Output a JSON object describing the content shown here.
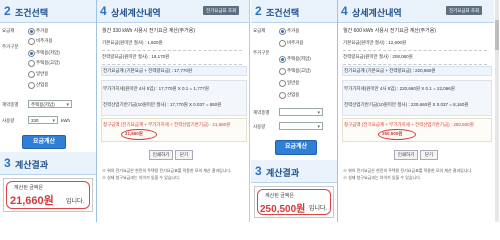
{
  "left": {
    "sidebar": {
      "step_num": "2",
      "step_title": "조건선택",
      "labels": [
        "요금제",
        "주거구분",
        "계약종별",
        "사용량"
      ],
      "radios": [
        "주거용",
        "비주거용",
        "주택용(저압)",
        "주택용(고압)",
        "일반용",
        "산업용"
      ],
      "select_value": "주택용(저압)",
      "usage_value": "330",
      "usage_unit": "kWh",
      "calc_button": "요금계산"
    },
    "result": {
      "step_num": "3",
      "step_title": "계산결과",
      "label": "계산된 금액은",
      "value": "21,660원",
      "unit": "입니다."
    },
    "main": {
      "step_num": "4",
      "step_title": "상세계산내역",
      "subtitle": "월간 330 kWh 사용시 전기요금 계산(주거용)",
      "header_button": "전기요금표 조회",
      "lines": [
        "기본요금(원미만 절사) : 1,600원",
        "전력량요금(원미만 절사) : 16,170원",
        "전기요금계 (기본요금 + 전력량요금) : 17,770원",
        "부가가치세(원미만 4사 5입) : 17,770원 X 0.1 = 1,777원",
        "전력산업기반기금(10원미만 절사) : 17,770원 X 0.037 = 650원",
        "청구금액 (전기요금계 + 부가가치세 + 전력산업기반기금) : 21,660원"
      ],
      "highlight_value": "21,660원",
      "buttons": [
        "인쇄하기",
        "닫기"
      ],
      "notes": [
        "※ 위의 전기요금은 한전의 주택용 전기요금표를 적용한 모의 계산 결과입니다.",
        "※ 실제 청구요금과는 차이가 있을 수 있습니다."
      ]
    }
  },
  "right": {
    "sidebar": {
      "step_num": "2",
      "step_title": "조건선택",
      "labels": [
        "요금제",
        "주거구분",
        "계약종별",
        "사용량"
      ],
      "radios": [
        "주거용",
        "비주거용",
        "주택용(저압)",
        "주택용(고압)",
        "일반용",
        "산업용"
      ],
      "calc_button": "요금계산"
    },
    "result": {
      "step_num": "3",
      "step_title": "계산결과",
      "label": "계산된 금액은",
      "value": "250,500원",
      "unit": "입니다."
    },
    "main": {
      "step_num": "4",
      "step_title": "상세계산내역",
      "subtitle": "월간 600 kWh 사용시 전기요금 계산(주거용)",
      "header_button": "전기요금표 조회",
      "lines": [
        "기본요금(원미만 절사) : 12,600원",
        "전력량요금(원미만 절사) : 208,060원",
        "전기요금계 (기본요금 + 전력량요금) : 220,660원",
        "부가가치세(원미만 4사 5입) : 220,660원 X 0.1 = 22,066원",
        "전력산업기반기금(10원미만 절사) : 220,660원 X 0.037 = 8,160원",
        "청구금액 (전기요금계 + 부가가치세 + 전력산업기반기금) : 250,500원"
      ],
      "highlight_value": "250,500원",
      "buttons": [
        "인쇄하기",
        "닫기"
      ],
      "notes": [
        "※ 위의 전기요금은 한전의 주택용 전기요금표를 적용한 모의 계산 결과입니다.",
        "※ 실제 청구요금과는 차이가 있을 수 있습니다."
      ]
    }
  },
  "colors": {
    "accent": "#2a73c4",
    "highlight_red": "#d23a3a",
    "header_bg": "#eaf3fc"
  }
}
